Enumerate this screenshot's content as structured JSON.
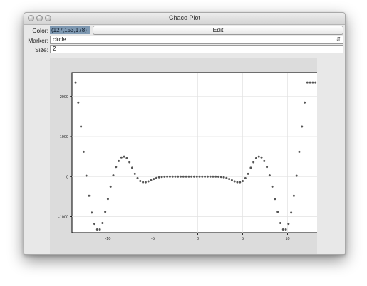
{
  "window": {
    "title": "Chaco Plot"
  },
  "controls": {
    "color_label": "Color:",
    "color_value": "(127,153,178)",
    "edit_label": "Edit",
    "marker_label": "Marker:",
    "marker_value": "circle",
    "size_label": "Size:",
    "size_value": "2"
  },
  "colors": {
    "marker_color": "#7f99b2",
    "point_fill": "#555555"
  },
  "chart_data": {
    "type": "scatter",
    "marker": "circle",
    "marker_size": 2,
    "xlim": [
      -14,
      14
    ],
    "ylim": [
      -1400,
      2600
    ],
    "x_ticks": [
      -10,
      -5,
      0,
      5,
      10
    ],
    "y_ticks": [
      -1000,
      0,
      1000,
      2000
    ],
    "x_tick_labels": [
      "-10",
      "-5",
      "0",
      "5",
      "10"
    ],
    "y_tick_labels": [
      "-1000",
      "0",
      "1000",
      "2000"
    ],
    "grid": true,
    "x": [
      -13.6,
      -13.3,
      -13.0,
      -12.7,
      -12.4,
      -12.1,
      -11.8,
      -11.5,
      -11.2,
      -10.9,
      -10.6,
      -10.3,
      -10.0,
      -9.7,
      -9.4,
      -9.1,
      -8.8,
      -8.5,
      -8.2,
      -7.9,
      -7.6,
      -7.3,
      -7.0,
      -6.7,
      -6.4,
      -6.1,
      -5.8,
      -5.5,
      -5.2,
      -4.9,
      -4.6,
      -4.3,
      -4.0,
      -3.7,
      -3.4,
      -3.1,
      -2.8,
      -2.5,
      -2.2,
      -1.9,
      -1.6,
      -1.3,
      -1.0,
      -0.7,
      -0.4,
      -0.1,
      0.2,
      0.5,
      0.8,
      1.1,
      1.4,
      1.7,
      2.0,
      2.3,
      2.6,
      2.9,
      3.2,
      3.5,
      3.8,
      4.1,
      4.4,
      4.7,
      5.0,
      5.3,
      5.6,
      5.9,
      6.2,
      6.5,
      6.8,
      7.1,
      7.4,
      7.7,
      8.0,
      8.3,
      8.6,
      8.9,
      9.2,
      9.5,
      9.8,
      10.1,
      10.4,
      10.7,
      11.0,
      11.3,
      11.6,
      11.9,
      12.2,
      12.5,
      12.8,
      13.1,
      13.4,
      13.7
    ],
    "y": [
      2350,
      1850,
      1250,
      620,
      20,
      -480,
      -900,
      -1180,
      -1320,
      -1320,
      -1160,
      -880,
      -560,
      -250,
      30,
      240,
      390,
      480,
      500,
      460,
      360,
      220,
      70,
      -40,
      -110,
      -140,
      -140,
      -120,
      -90,
      -60,
      -35,
      -18,
      -8,
      -2,
      0,
      0,
      0,
      0,
      0,
      0,
      0,
      0,
      0,
      0,
      0,
      0,
      0,
      0,
      0,
      0,
      0,
      0,
      0,
      -2,
      -8,
      -18,
      -35,
      -60,
      -90,
      -120,
      -140,
      -140,
      -110,
      -40,
      70,
      220,
      360,
      460,
      500,
      480,
      390,
      240,
      30,
      -250,
      -560,
      -880,
      -1160,
      -1320,
      -1320,
      -1180,
      -900,
      -480,
      20,
      620,
      1250,
      1850,
      2350,
      2350,
      2350,
      2350,
      2350,
      2350
    ]
  }
}
